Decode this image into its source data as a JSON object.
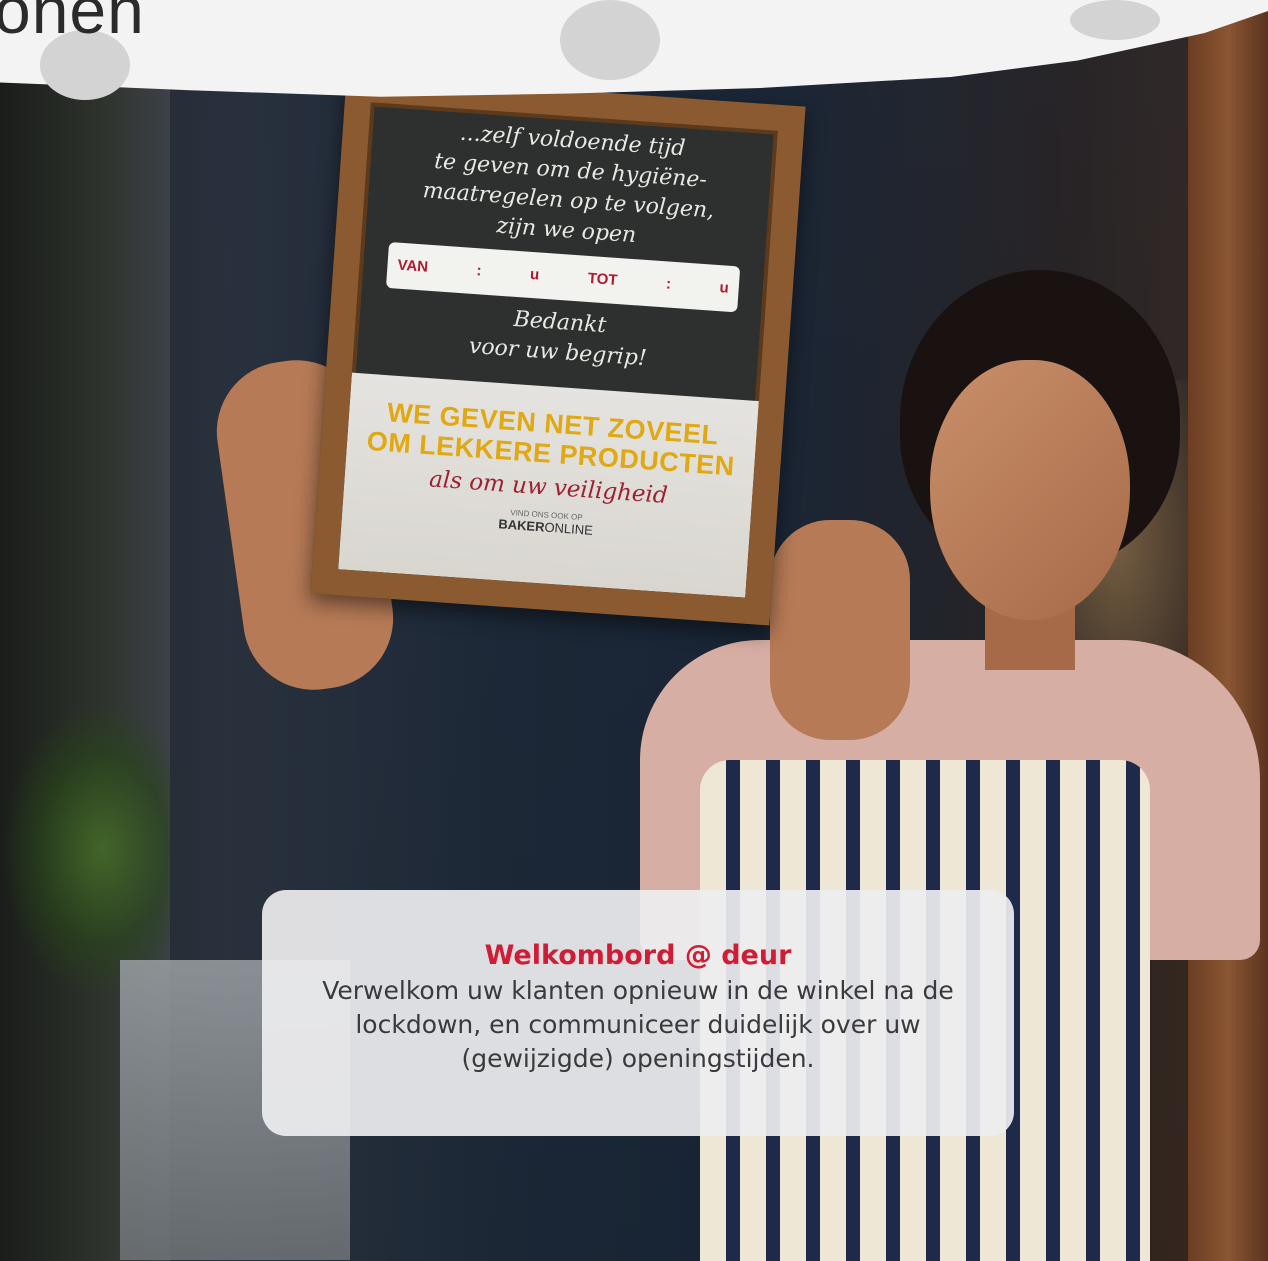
{
  "heading_fragment": "onen",
  "sign": {
    "chalk_lines": [
      "...zelf voldoende tijd",
      "te geven om de hygiëne-",
      "maatregelen op te volgen,",
      "zijn we open"
    ],
    "hours": {
      "van": "VAN",
      "sep1": ":",
      "u1": "u",
      "tot": "TOT",
      "sep2": ":",
      "u2": "u"
    },
    "thanks_line1": "Bedankt",
    "thanks_line2": "voor uw begrip!",
    "slogan_line1": "WE GEVEN NET ZOVEEL",
    "slogan_line2": "OM LEKKERE PRODUCTEN",
    "slogan_line3": "als om uw veiligheid",
    "brand_small": "VIND ONS OOK OP",
    "brand_bold": "BAKER",
    "brand_light": "ONLINE"
  },
  "card": {
    "title": "Welkombord @ deur",
    "text": "Verwelkom uw klanten opnieuw in de winkel na de lockdown, en communiceer duidelijk over uw (gewijzigde) openingstijden."
  },
  "colors": {
    "accent_red": "#d01d36",
    "slogan_yellow": "#e0a812"
  }
}
